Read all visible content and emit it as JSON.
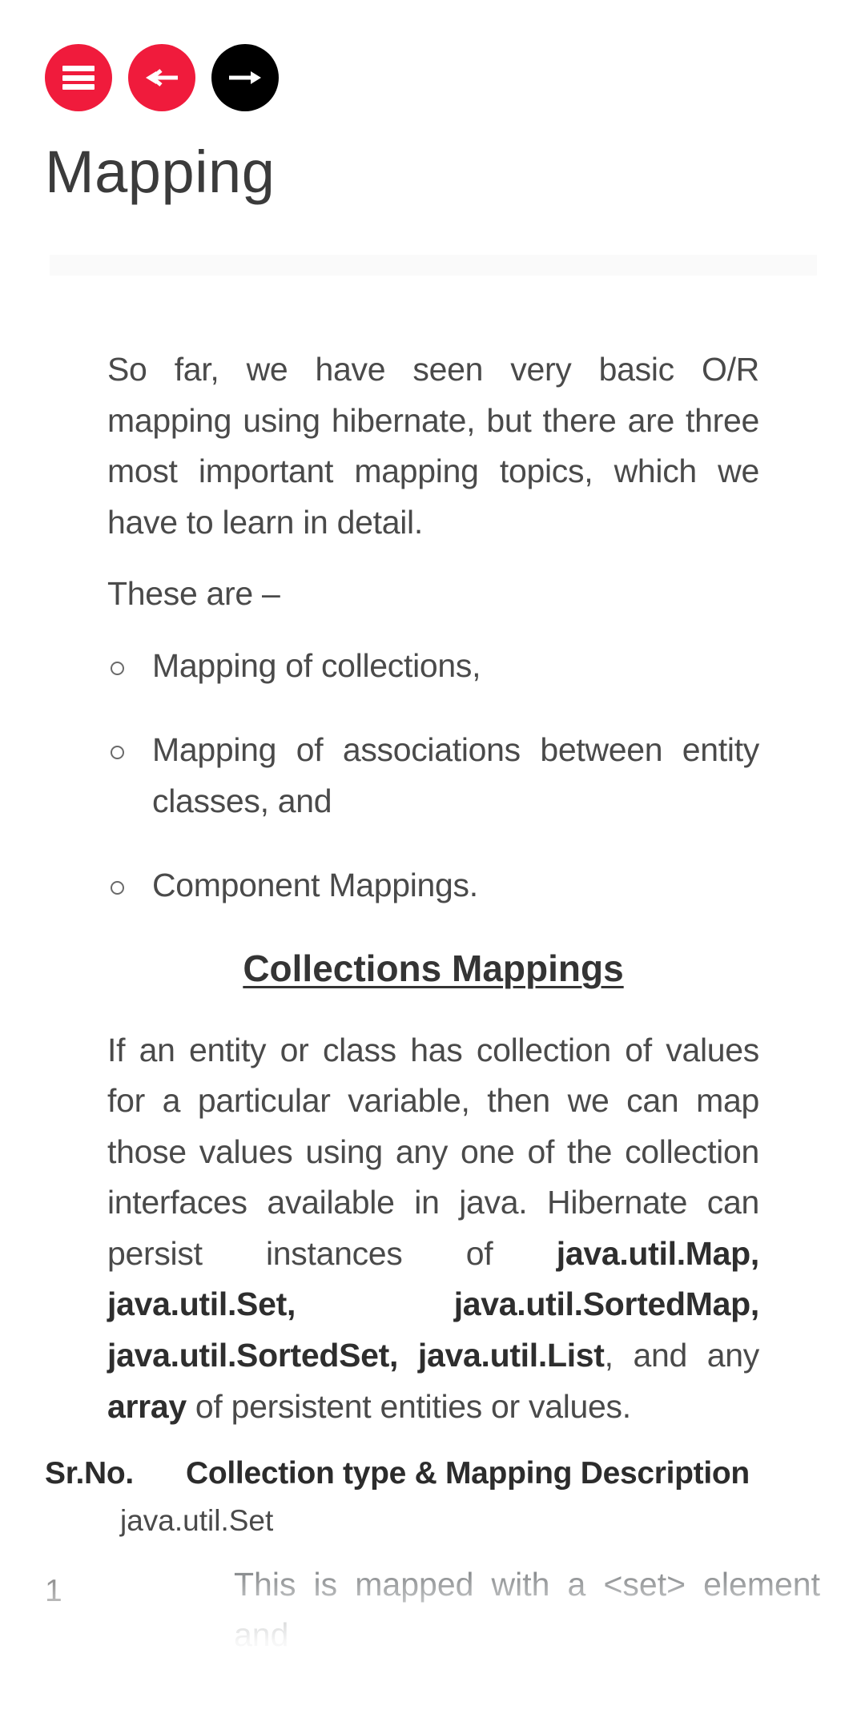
{
  "theme": {
    "accent_red": "#F01B3C",
    "accent_black": "#000000",
    "text": "#4a4a4a",
    "strip": "#fafafa"
  },
  "toolbar": {
    "menu_label": "Menu",
    "prev_label": "Previous",
    "next_label": "Next",
    "menu_icon": "hamburger-icon",
    "prev_icon": "arrow-left-icon",
    "next_icon": "arrow-right-icon"
  },
  "page": {
    "title": "Mapping"
  },
  "article": {
    "intro_paragraph": "So far, we have seen very basic O/R mapping using hibernate, but there are three most important mapping topics, which we have to learn in detail.",
    "lead_in": "These are –",
    "bullets": [
      "Mapping of collections,",
      "Mapping of associations between entity classes, and",
      "Component Mappings."
    ],
    "section_heading": "Collections Mappings",
    "body_parts": [
      {
        "text": "If an entity or class has collection of values for a particular variable, then we can map those values using any one of the collection interfaces available in java. Hibernate can persist instances of ",
        "bold": false
      },
      {
        "text": "java.util.Map,",
        "bold": true
      },
      {
        "text": " ",
        "bold": false
      },
      {
        "text": "java.util.Set,",
        "bold": true
      },
      {
        "text": " ",
        "bold": false
      },
      {
        "text": "java.util.SortedMap,",
        "bold": true
      },
      {
        "text": " ",
        "bold": false
      },
      {
        "text": "java.util.SortedSet,",
        "bold": true
      },
      {
        "text": " ",
        "bold": false
      },
      {
        "text": "java.util.List",
        "bold": true
      },
      {
        "text": ", and any ",
        "bold": false
      },
      {
        "text": "array",
        "bold": true
      },
      {
        "text": " of persistent entities or values.",
        "bold": false
      }
    ]
  },
  "table": {
    "headers": {
      "sr_no": "Sr.No.",
      "description": "Collection type & Mapping Description"
    },
    "rows": [
      {
        "sr_no": "1",
        "type": "java.util.Set",
        "description": "This is mapped with a <set> element and"
      }
    ]
  }
}
